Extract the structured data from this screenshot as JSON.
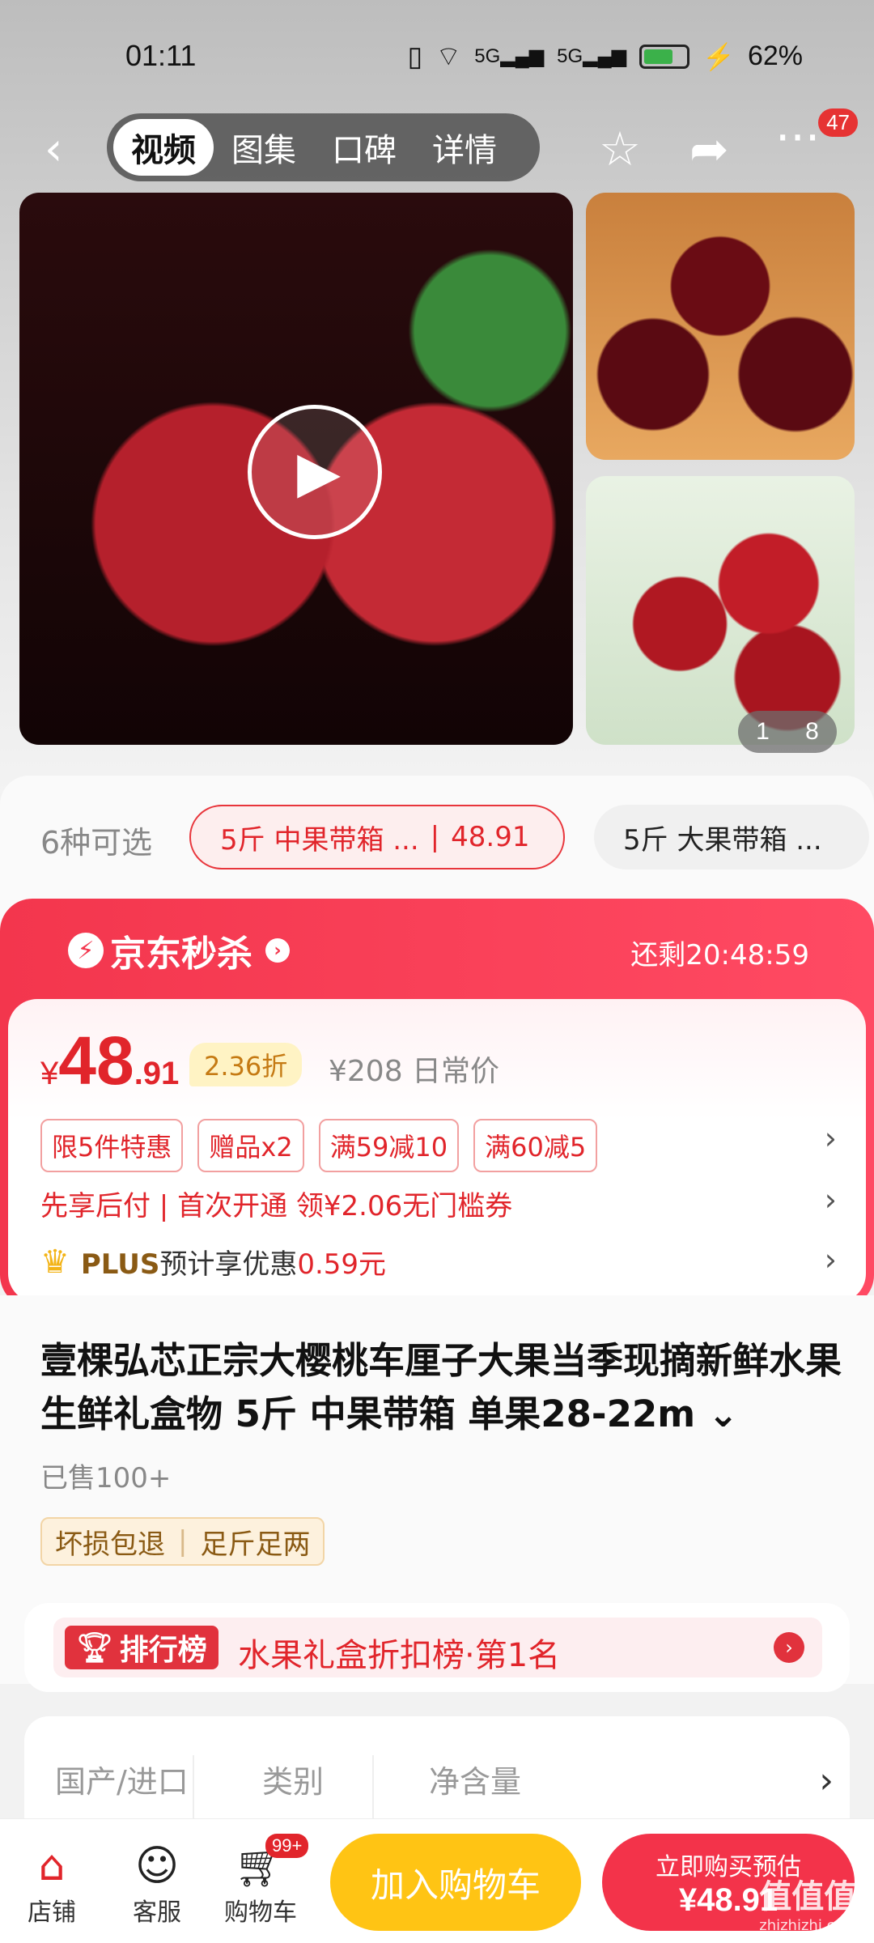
{
  "status": {
    "time": "01:11",
    "battery": "62%",
    "net1": "5G",
    "net2": "5G"
  },
  "nav": {
    "tabs": [
      {
        "label": "视频",
        "active": true
      },
      {
        "label": "图集",
        "active": false
      },
      {
        "label": "口碑",
        "active": false
      },
      {
        "label": "详情",
        "active": false
      }
    ],
    "more_badge": "47"
  },
  "gallery": {
    "page_current": "1",
    "page_total": "8"
  },
  "variants": {
    "count_label": "6种可选",
    "selected": {
      "name": "5斤 中果带箱 ...",
      "price": "48.91"
    },
    "other": {
      "name": "5斤 大果带箱 ..."
    }
  },
  "flash_sale": {
    "title": "京东秒杀",
    "timer": "还剩20:48:59",
    "price_currency": "¥",
    "price_int": "48",
    "price_dec": ".91",
    "discount": "2.36折",
    "original_price": "¥208 日常价",
    "promos": [
      "限5件特惠",
      "赠品x2",
      "满59减10",
      "满60减5"
    ],
    "pay_later": "先享后付 | 首次开通 领¥2.06无门槛券",
    "plus_label": "PLUS",
    "plus_text": "预计享优惠",
    "plus_value": "0.59元"
  },
  "product": {
    "title": "壹棵弘芯正宗大樱桃车厘子大果当季现摘新鲜水果生鲜礼盒物 5斤 中果带箱 单果28-22m",
    "sold": "已售100+",
    "tags": [
      "坏损包退",
      "足斤足两"
    ],
    "rank_badge": "排行榜",
    "rank_text": "水果礼盒折扣榜·第1名"
  },
  "specs": [
    "国产/进口",
    "类别",
    "净含量"
  ],
  "bottom": {
    "store": "店铺",
    "service": "客服",
    "cart": "购物车",
    "cart_badge": "99+",
    "add_cart": "加入购物车",
    "buy_line1": "立即购买预估",
    "buy_line2": "¥48.91"
  },
  "watermark": {
    "main": "值值值",
    "sub": "zhizhizhi.com"
  }
}
